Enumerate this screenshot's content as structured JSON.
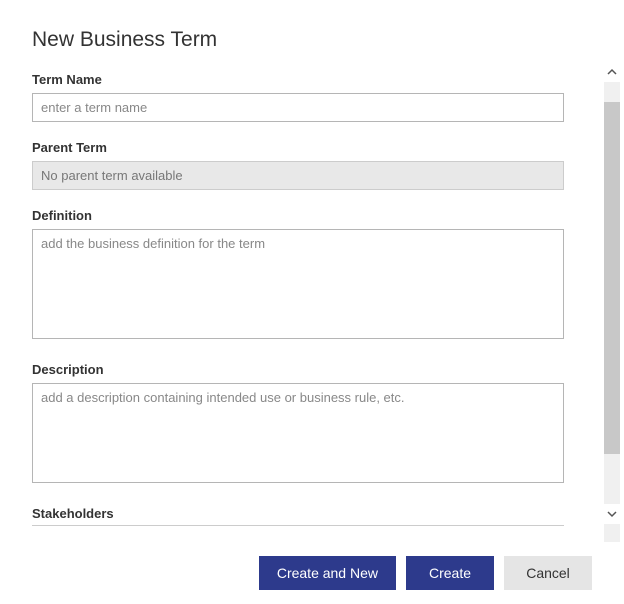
{
  "header": {
    "title": "New Business Term"
  },
  "form": {
    "term_name": {
      "label": "Term Name",
      "placeholder": "enter a term name",
      "value": ""
    },
    "parent_term": {
      "label": "Parent Term",
      "value": "No parent term available"
    },
    "definition": {
      "label": "Definition",
      "placeholder": "add the business definition for the term",
      "value": ""
    },
    "description": {
      "label": "Description",
      "placeholder": "add a description containing intended use or business rule, etc.",
      "value": ""
    },
    "stakeholders": {
      "label": "Stakeholders"
    }
  },
  "buttons": {
    "create_and_new": "Create and New",
    "create": "Create",
    "cancel": "Cancel"
  }
}
